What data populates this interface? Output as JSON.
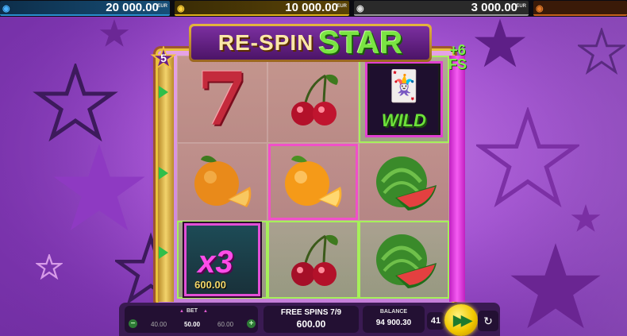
{
  "jackpots": [
    {
      "icon": "blue-mask-icon",
      "value": "20 000.00",
      "currency": "EUR"
    },
    {
      "icon": "gold-mask-icon",
      "value": "10 000.00",
      "currency": "EUR"
    },
    {
      "icon": "silver-mask-icon",
      "value": "3 000.00",
      "currency": "EUR"
    },
    {
      "icon": "bronze-mask-icon",
      "value": "",
      "currency": ""
    }
  ],
  "title": {
    "part1": "RE-SPIN",
    "part2": "STAR"
  },
  "respins_remaining": "5",
  "bonus_fs": {
    "amount": "+6",
    "unit": "FS"
  },
  "reels": {
    "symbols": [
      [
        "seven",
        "cherry",
        "wild"
      ],
      [
        "orange",
        "orange",
        "watermelon"
      ],
      [
        "multiplier",
        "cherry",
        "watermelon"
      ]
    ],
    "wild_label": "WILD",
    "multiplier_label": "x3",
    "multiplier_value": "600.00"
  },
  "bet": {
    "label": "BET",
    "prev": "40.00",
    "current": "50.00",
    "next": "60.00"
  },
  "free_spins": {
    "label": "FREE SPINS 7/9",
    "win": "600.00"
  },
  "balance": {
    "label": "BALANCE",
    "value": "94 900.30"
  },
  "lines": "41"
}
